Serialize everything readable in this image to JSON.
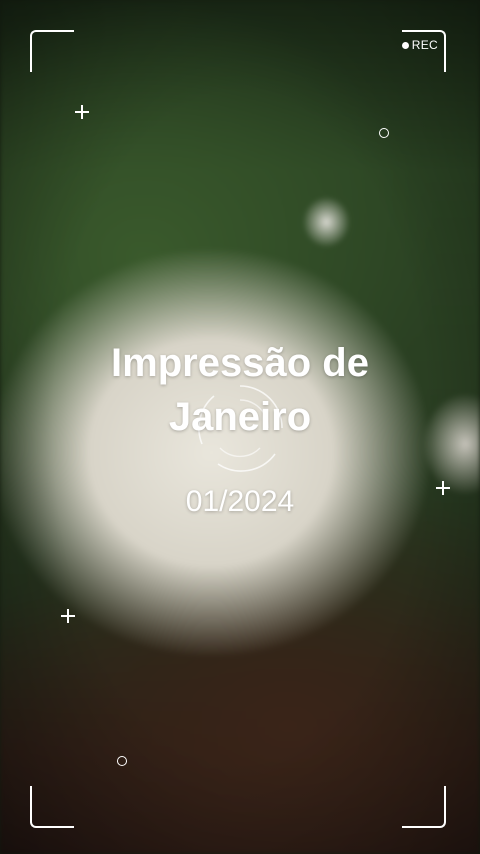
{
  "overlay": {
    "rec_label": "REC",
    "title_line1": "Impressão de",
    "title_line2": "Janeiro",
    "date": "01/2024"
  },
  "icons": {
    "corners": [
      "corner-top-left-icon",
      "corner-top-right-icon",
      "corner-bottom-left-icon",
      "corner-bottom-right-icon"
    ],
    "decor": [
      "plus-icon",
      "circle-icon",
      "focus-ring-icon",
      "record-dot-icon"
    ]
  },
  "colors": {
    "overlay": "#ffffff",
    "foliage": "#2c4524",
    "soil": "#2b1d16",
    "mushroom": "#e9e6dc"
  }
}
